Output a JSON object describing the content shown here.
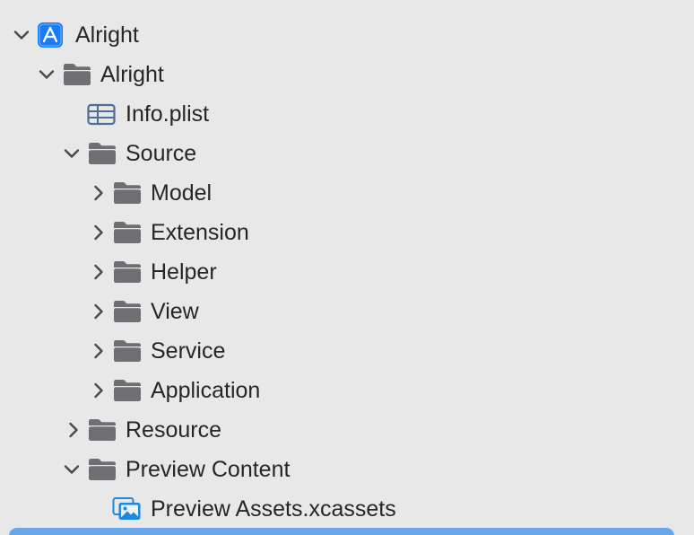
{
  "navigator": {
    "items": [
      {
        "label": "Alright",
        "depth": 0,
        "expanded": true,
        "icon": "app-project-icon"
      },
      {
        "label": "Alright",
        "depth": 1,
        "expanded": true,
        "icon": "folder-icon"
      },
      {
        "label": "Info.plist",
        "depth": 2,
        "expanded": null,
        "icon": "plist-table-icon"
      },
      {
        "label": "Source",
        "depth": 2,
        "expanded": true,
        "icon": "folder-icon"
      },
      {
        "label": "Model",
        "depth": 3,
        "expanded": false,
        "icon": "folder-icon"
      },
      {
        "label": "Extension",
        "depth": 3,
        "expanded": false,
        "icon": "folder-icon"
      },
      {
        "label": "Helper",
        "depth": 3,
        "expanded": false,
        "icon": "folder-icon"
      },
      {
        "label": "View",
        "depth": 3,
        "expanded": false,
        "icon": "folder-icon"
      },
      {
        "label": "Service",
        "depth": 3,
        "expanded": false,
        "icon": "folder-icon"
      },
      {
        "label": "Application",
        "depth": 3,
        "expanded": false,
        "icon": "folder-icon"
      },
      {
        "label": "Resource",
        "depth": 2,
        "expanded": false,
        "icon": "folder-icon"
      },
      {
        "label": "Preview Content",
        "depth": 2,
        "expanded": true,
        "icon": "folder-icon"
      },
      {
        "label": "Preview Assets.xcassets",
        "depth": 3,
        "expanded": null,
        "icon": "asset-catalog-icon"
      }
    ]
  },
  "colors": {
    "background": "#e8e8e8",
    "text": "#262626",
    "folder": "#6e6e73",
    "chevron": "#4a4a4a",
    "app_icon": "#1a7cf5",
    "asset_icon": "#1f88d8",
    "selection": "#6aa6ea"
  }
}
